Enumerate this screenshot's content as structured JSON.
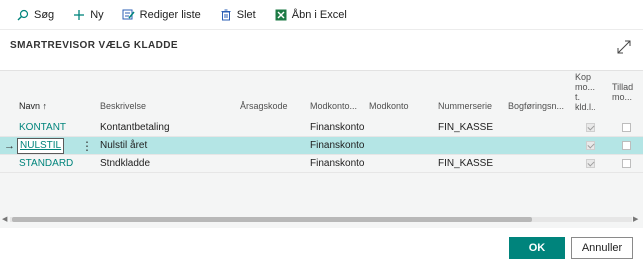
{
  "toolbar": {
    "search_label": "Søg",
    "new_label": "Ny",
    "edit_list_label": "Rediger liste",
    "delete_label": "Slet",
    "excel_label": "Åbn i Excel"
  },
  "page": {
    "title": "SMARTREVISOR VÆLG KLADDE"
  },
  "columns": {
    "navn": "Navn ↑",
    "beskrivelse": "Beskrivelse",
    "aarsagskode": "Årsagskode",
    "modkontotype": "Modkonto...",
    "modkonto": "Modkonto",
    "nummerserie": "Nummerserie",
    "bogfoering": "Bogføringsn...",
    "kopier": "Kop mo... t. kld.l...",
    "tillad": "Tillad mo..."
  },
  "rows": [
    {
      "navn": "KONTANT",
      "beskrivelse": "Kontantbetaling",
      "modkontotype": "Finanskonto",
      "nummerserie": "FIN_KASSE",
      "kopier": true,
      "tillad": false
    },
    {
      "navn": "NULSTIL",
      "beskrivelse": "Nulstil året",
      "modkontotype": "Finanskonto",
      "nummerserie": "",
      "kopier": true,
      "tillad": false,
      "selected": true
    },
    {
      "navn": "STANDARD",
      "beskrivelse": "Stndkladde",
      "modkontotype": "Finanskonto",
      "nummerserie": "FIN_KASSE",
      "kopier": true,
      "tillad": false
    }
  ],
  "selection_arrow": "→",
  "row_menu": "⋮",
  "footer": {
    "ok_label": "OK",
    "cancel_label": "Annuller"
  },
  "colors": {
    "accent": "#00847c",
    "selected_row": "#b4e5e5"
  }
}
